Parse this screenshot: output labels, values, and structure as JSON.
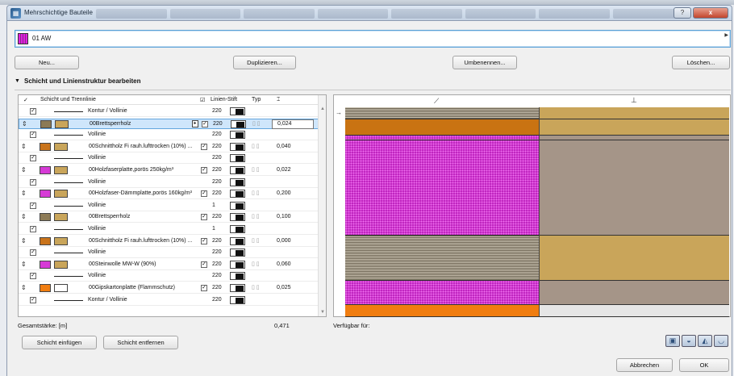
{
  "window": {
    "title": "Mehrschichtige Bauteile",
    "help": "?",
    "close": "x"
  },
  "selector": {
    "value": "01 AW"
  },
  "toolbar": {
    "new": "Neu...",
    "duplicate": "Duplizieren...",
    "rename": "Umbenennen...",
    "delete": "Löschen..."
  },
  "section": {
    "title": "Schicht und Linienstruktur bearbeiten"
  },
  "table": {
    "headers": {
      "layer": "Schicht und Trennlinie",
      "pen": "Linien-Stift",
      "type": "Typ"
    },
    "rows": [
      {
        "kind": "line",
        "label": "Kontur / Vollinie",
        "pen": "220"
      },
      {
        "kind": "layer",
        "label": "00Brettsperrholz",
        "pen": "220",
        "thickness": "0,024",
        "swatch": "#8c7a55",
        "fill": "#c9a55a",
        "selected": true
      },
      {
        "kind": "line",
        "label": "Vollinie",
        "pen": "220"
      },
      {
        "kind": "layer",
        "label": "00Schnittholz Fi rauh.lufttrocken (10%) ...",
        "pen": "220",
        "thickness": "0,040",
        "swatch": "#c9731a",
        "fill": "#c9a55a"
      },
      {
        "kind": "line",
        "label": "Vollinie",
        "pen": "220"
      },
      {
        "kind": "layer",
        "label": "00Holzfaserplatte,porös 250kg/m³",
        "pen": "220",
        "thickness": "0,022",
        "swatch": "#d63ad6",
        "fill": "#c9a55a"
      },
      {
        "kind": "line",
        "label": "Vollinie",
        "pen": "220"
      },
      {
        "kind": "layer",
        "label": "00Holzfaser-Dämmplatte,porös 160kg/m³",
        "pen": "220",
        "thickness": "0,200",
        "swatch": "#d63ad6",
        "fill": "#c9a55a"
      },
      {
        "kind": "line",
        "label": "Vollinie",
        "pen": "1"
      },
      {
        "kind": "layer",
        "label": "00Brettsperrholz",
        "pen": "220",
        "thickness": "0,100",
        "swatch": "#8c7a55",
        "fill": "#c9a55a"
      },
      {
        "kind": "line",
        "label": "Vollinie",
        "pen": "1"
      },
      {
        "kind": "layer",
        "label": "00Schnittholz Fi rauh.lufttrocken (10%) ...",
        "pen": "220",
        "thickness": "0,000",
        "swatch": "#c9731a",
        "fill": "#c9a55a"
      },
      {
        "kind": "line",
        "label": "Vollinie",
        "pen": "220"
      },
      {
        "kind": "layer",
        "label": "00Steinwolle MW-W (90%)",
        "pen": "220",
        "thickness": "0,060",
        "swatch": "#d63ad6",
        "fill": "#c9a55a"
      },
      {
        "kind": "line",
        "label": "Vollinie",
        "pen": "220"
      },
      {
        "kind": "layer",
        "label": "00Gipskartonplatte (Flammschutz)",
        "pen": "220",
        "thickness": "0,025",
        "swatch": "#f07d10",
        "fill": "#ffffff"
      },
      {
        "kind": "line",
        "label": "Kontur / Vollinie",
        "pen": "220"
      }
    ],
    "total_label": "Gesamtstärke: [m]",
    "total_value": "0,471"
  },
  "buttons": {
    "insert": "Schicht einfügen",
    "remove": "Schicht entfernen",
    "cancel": "Abbrechen",
    "ok": "OK"
  },
  "preview": {
    "available_label": "Verfügbar für:"
  }
}
